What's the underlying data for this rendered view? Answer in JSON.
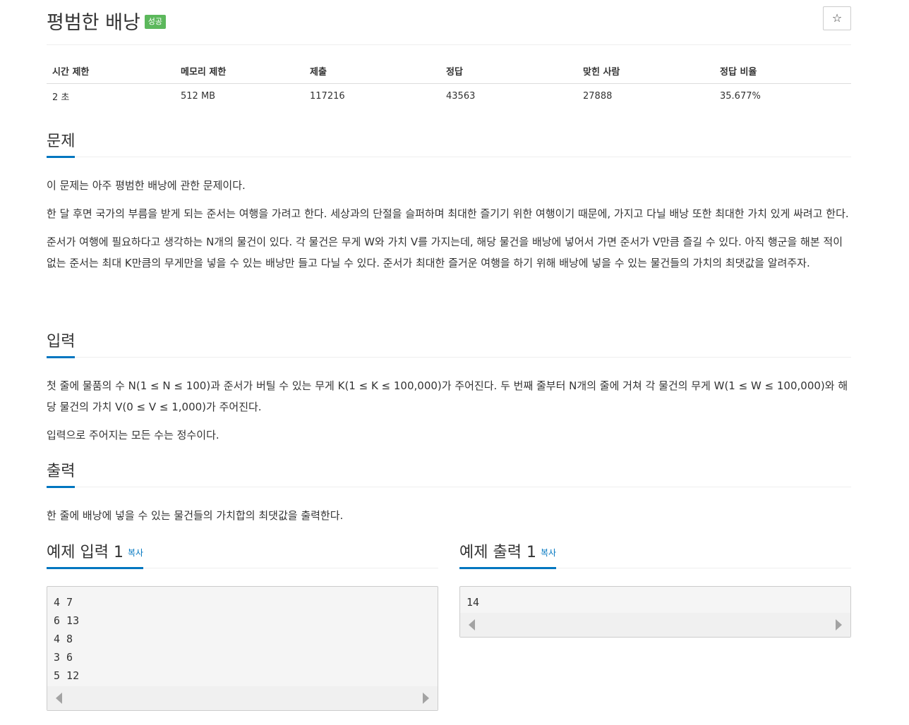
{
  "header": {
    "title": "평범한 배낭",
    "badge": "성공",
    "star": "☆"
  },
  "info_table": {
    "headers": [
      "시간 제한",
      "메모리 제한",
      "제출",
      "정답",
      "맞힌 사람",
      "정답 비율"
    ],
    "values": [
      "2 초",
      "512 MB",
      "117216",
      "43563",
      "27888",
      "35.677%"
    ]
  },
  "problem": {
    "heading": "문제",
    "paragraphs": [
      "이 문제는 아주 평범한 배낭에 관한 문제이다.",
      "한 달 후면 국가의 부름을 받게 되는 준서는 여행을 가려고 한다. 세상과의 단절을 슬퍼하며 최대한 즐기기 위한 여행이기 때문에, 가지고 다닐 배낭 또한 최대한 가치 있게 싸려고 한다.",
      "준서가 여행에 필요하다고 생각하는 N개의 물건이 있다. 각 물건은 무게 W와 가치 V를 가지는데, 해당 물건을 배낭에 넣어서 가면 준서가 V만큼 즐길 수 있다. 아직 행군을 해본 적이 없는 준서는 최대 K만큼의 무게만을 넣을 수 있는 배낭만 들고 다닐 수 있다. 준서가 최대한 즐거운 여행을 하기 위해 배낭에 넣을 수 있는 물건들의 가치의 최댓값을 알려주자."
    ]
  },
  "input": {
    "heading": "입력",
    "paragraphs": [
      "첫 줄에 물품의 수 N(1 ≤ N ≤ 100)과 준서가 버틸 수 있는 무게 K(1 ≤ K ≤ 100,000)가 주어진다. 두 번째 줄부터 N개의 줄에 거쳐 각 물건의 무게 W(1 ≤ W ≤ 100,000)와 해당 물건의 가치 V(0 ≤ V ≤ 1,000)가 주어진다.",
      "입력으로 주어지는 모든 수는 정수이다."
    ]
  },
  "output": {
    "heading": "출력",
    "paragraphs": [
      "한 줄에 배낭에 넣을 수 있는 물건들의 가치합의 최댓값을 출력한다."
    ]
  },
  "example_input": {
    "heading": "예제 입력 1",
    "copy": "복사",
    "content": "4 7\n6 13\n4 8\n3 6\n5 12"
  },
  "example_output": {
    "heading": "예제 출력 1",
    "copy": "복사",
    "content": "14"
  }
}
